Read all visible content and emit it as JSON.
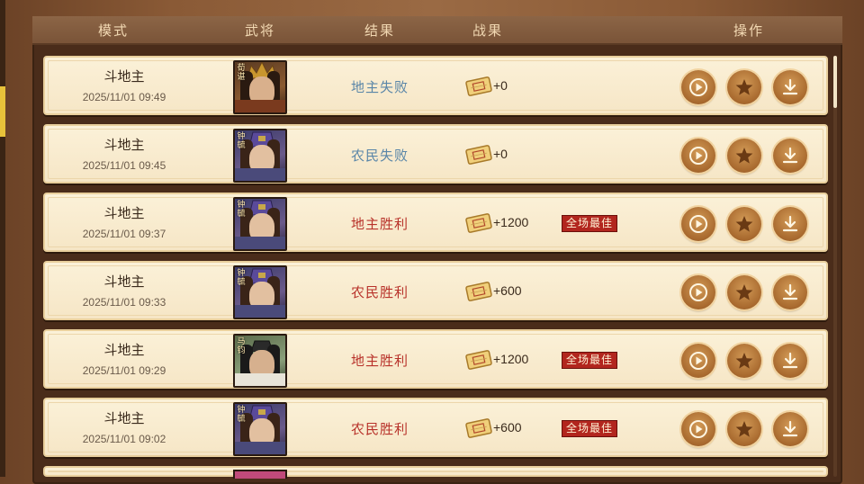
{
  "header": {
    "mode": "模式",
    "general": "武将",
    "result": "结果",
    "reward": "战果",
    "action": "操作"
  },
  "colors": {
    "win": "#b8322a",
    "lose": "#5a86a8",
    "mvp_badge": "#b2261e",
    "button": "#b8762e"
  },
  "records": [
    {
      "mode": "斗地主",
      "time": "2025/11/01 09:49",
      "general_tag": "荀谌",
      "result": "地主失败",
      "outcome": "lose",
      "score": "+0",
      "mvp": ""
    },
    {
      "mode": "斗地主",
      "time": "2025/11/01 09:45",
      "general_tag": "钟毓",
      "result": "农民失败",
      "outcome": "lose",
      "score": "+0",
      "mvp": ""
    },
    {
      "mode": "斗地主",
      "time": "2025/11/01 09:37",
      "general_tag": "钟毓",
      "result": "地主胜利",
      "outcome": "win",
      "score": "+1200",
      "mvp": "全场最佳"
    },
    {
      "mode": "斗地主",
      "time": "2025/11/01 09:33",
      "general_tag": "钟毓",
      "result": "农民胜利",
      "outcome": "win",
      "score": "+600",
      "mvp": ""
    },
    {
      "mode": "斗地主",
      "time": "2025/11/01 09:29",
      "general_tag": "马钧",
      "result": "地主胜利",
      "outcome": "win",
      "score": "+1200",
      "mvp": "全场最佳"
    },
    {
      "mode": "斗地主",
      "time": "2025/11/01 09:02",
      "general_tag": "钟毓",
      "result": "农民胜利",
      "outcome": "win",
      "score": "+600",
      "mvp": "全场最佳"
    }
  ],
  "icons": {
    "reward": "ticket-icon",
    "replay": "play-icon",
    "favorite": "star-icon",
    "download": "download-icon"
  }
}
